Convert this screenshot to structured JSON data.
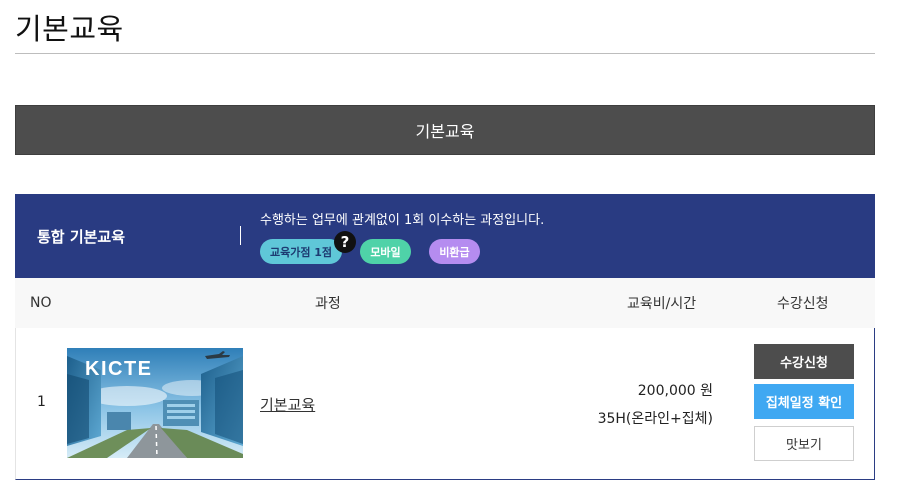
{
  "page": {
    "title": "기본교육"
  },
  "section": {
    "label": "기본교육"
  },
  "course_header": {
    "name": "통합 기본교육",
    "description": "수행하는 업무에 관계없이 1회 이수하는 과정입니다.",
    "tags": [
      "교육가점 1점",
      "모바일",
      "비환급"
    ],
    "help_icon": "?"
  },
  "table": {
    "headers": {
      "no": "NO",
      "course": "과정",
      "fee_time": "교육비/시간",
      "apply": "수강신청"
    },
    "rows": [
      {
        "no": "1",
        "thumbnail_text": "KICTE",
        "course": "기본교육",
        "price": "200,000 원",
        "hours": "35H(온라인+집체)",
        "buttons": {
          "apply": "수강신청",
          "schedule": "집체일정 확인",
          "preview": "맛보기"
        }
      }
    ]
  },
  "colors": {
    "header_bg": "#293b82",
    "section_bg": "#4d4d4d",
    "schedule_btn": "#3fa8f2"
  }
}
